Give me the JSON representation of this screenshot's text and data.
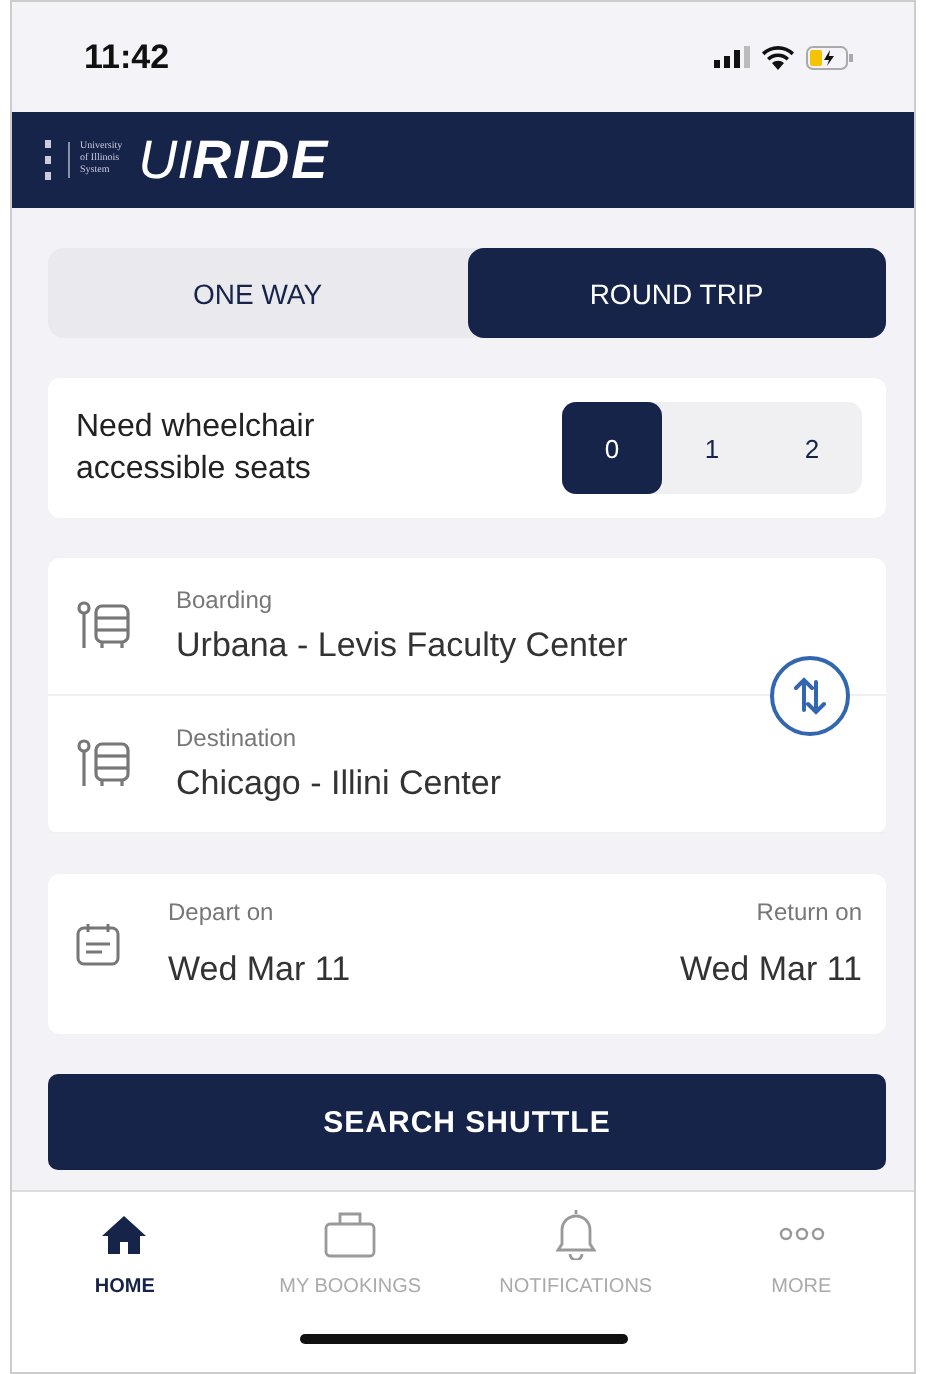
{
  "status_bar": {
    "time": "11:42"
  },
  "header": {
    "org_lines": [
      "University",
      "of Illinois",
      "System"
    ],
    "logo_prefix": "UI",
    "logo_main": "RIDE"
  },
  "trip_type": [
    {
      "label": "ONE WAY",
      "selected": false
    },
    {
      "label": "ROUND TRIP",
      "selected": true
    }
  ],
  "wheelchair": {
    "label": "Need wheelchair accessible seats",
    "options": [
      {
        "label": "0",
        "selected": true
      },
      {
        "label": "1",
        "selected": false
      },
      {
        "label": "2",
        "selected": false
      }
    ]
  },
  "route": [
    {
      "label": "Boarding",
      "value": "Urbana - Levis Faculty Center"
    },
    {
      "label": "Destination",
      "value": "Chicago - Illini Center"
    }
  ],
  "dates": {
    "depart_label": "Depart on",
    "depart_value": "Wed Mar 11",
    "return_label": "Return on",
    "return_value": "Wed Mar 11"
  },
  "search_button": "SEARCH SHUTTLE",
  "tab_bar": [
    {
      "kind": "home",
      "label": "HOME",
      "selected": true
    },
    {
      "kind": "bookings",
      "label": "MY BOOKINGS",
      "selected": false
    },
    {
      "kind": "notifications",
      "label": "NOTIFICATIONS",
      "selected": false
    },
    {
      "kind": "more",
      "label": "MORE",
      "selected": false
    }
  ]
}
